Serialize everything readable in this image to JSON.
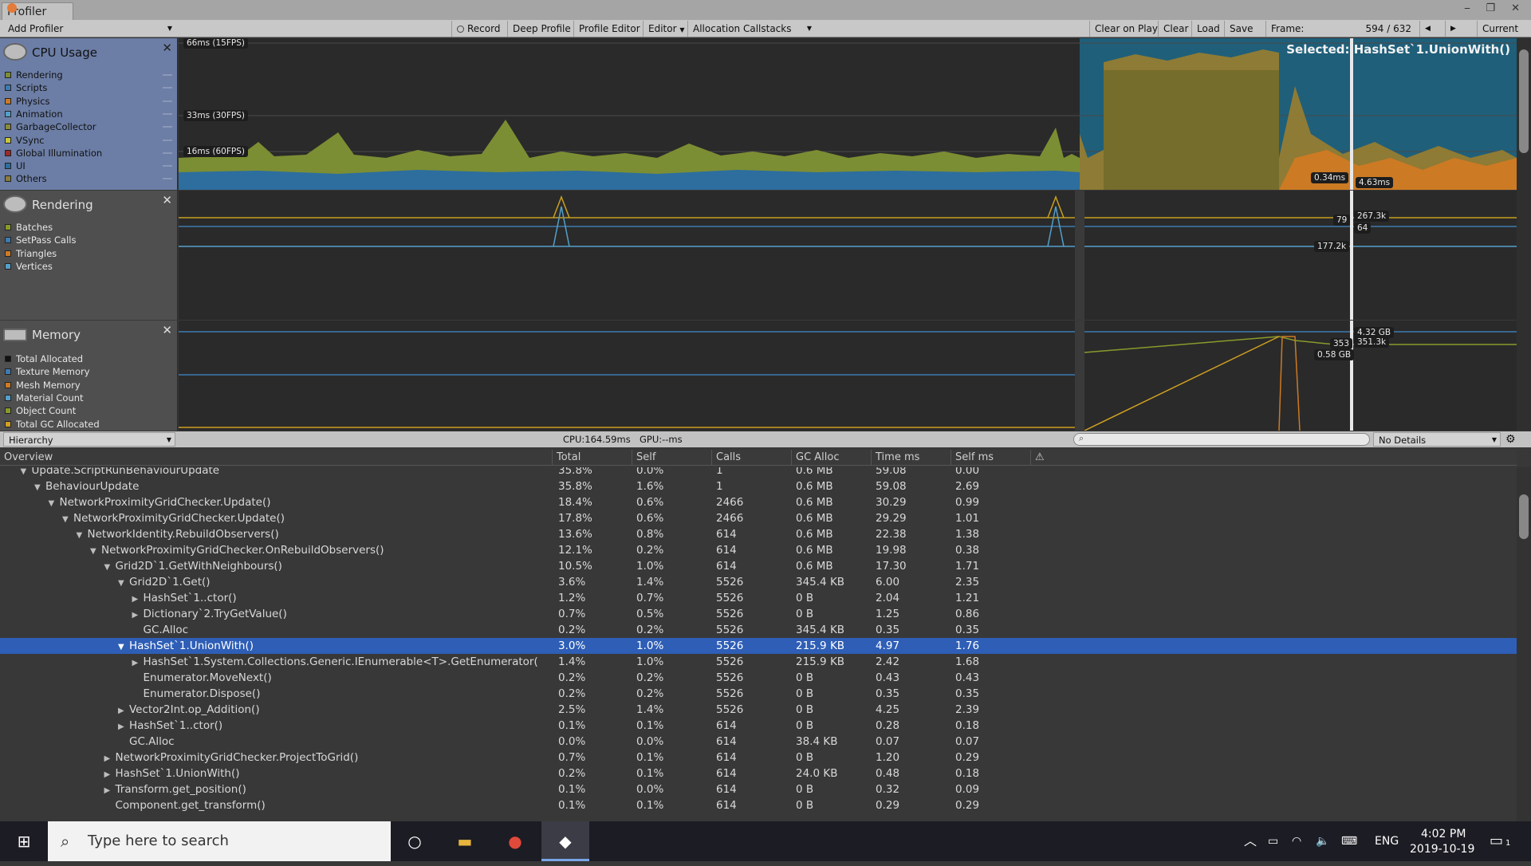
{
  "window": {
    "tab_title": "Profiler",
    "controls": "⎯ ❐ ✕"
  },
  "toolbar": {
    "add_profiler": "Add Profiler",
    "record": "Record",
    "deep_profile": "Deep Profile",
    "profile_editor": "Profile Editor",
    "editor": "Editor",
    "allocation_callstacks": "Allocation Callstacks",
    "clear_on_play": "Clear on Play",
    "clear": "Clear",
    "load": "Load",
    "save": "Save",
    "frame_label": "Frame:",
    "frame_value": "594 / 632",
    "prev": "◀",
    "next": "▶",
    "current": "Current"
  },
  "cpu": {
    "title": "CPU Usage",
    "items": [
      "Rendering",
      "Scripts",
      "Physics",
      "Animation",
      "GarbageCollector",
      "VSync",
      "Global Illumination",
      "UI",
      "Others"
    ],
    "colors": [
      "#7c8e33",
      "#3d7bb0",
      "#cc7a24",
      "#54a0c9",
      "#8a8a3a",
      "#c8c63a",
      "#9c2a2a",
      "#2d6e9e",
      "#8a7d3a"
    ],
    "label_66": "66ms (15FPS)",
    "label_33": "33ms (30FPS)",
    "label_16": "16ms (60FPS)",
    "selected": "Selected: HashSet`1.UnionWith()",
    "val_a": "0.34ms",
    "val_b": "4.63ms"
  },
  "rendering": {
    "title": "Rendering",
    "items": [
      "Batches",
      "SetPass Calls",
      "Triangles",
      "Vertices"
    ],
    "colors": [
      "#8a9a2a",
      "#3d7bb0",
      "#cc7a24",
      "#54a0c9"
    ],
    "val_79": "79",
    "val_267": "267.3k",
    "val_64": "64",
    "val_177": "177.2k"
  },
  "memory": {
    "title": "Memory",
    "items": [
      "Total Allocated",
      "Texture Memory",
      "Mesh Memory",
      "Material Count",
      "Object Count",
      "Total GC Allocated"
    ],
    "colors": [
      "#111111",
      "#3d7bb0",
      "#cc7a24",
      "#54a0c9",
      "#8a9a2a",
      "#d0a020"
    ],
    "val_432": "4.32 GB",
    "val_353": "353",
    "val_351": "351.3k",
    "val_058": "0.58 GB"
  },
  "strip": {
    "view": "Hierarchy",
    "cpu_time": "CPU:164.59ms",
    "gpu_time": "GPU:--ms",
    "details": "No Details"
  },
  "table": {
    "headers": [
      "Overview",
      "Total",
      "Self",
      "Calls",
      "GC Alloc",
      "Time ms",
      "Self ms"
    ],
    "rows": [
      {
        "depth": 1,
        "arrow": "▼",
        "name": "Update.ScriptRunBehaviourUpdate",
        "total": "35.8%",
        "self": "0.0%",
        "calls": "1",
        "gc": "0.6 MB",
        "time": "59.08",
        "selfms": "0.00"
      },
      {
        "depth": 2,
        "arrow": "▼",
        "name": "BehaviourUpdate",
        "total": "35.8%",
        "self": "1.6%",
        "calls": "1",
        "gc": "0.6 MB",
        "time": "59.08",
        "selfms": "2.69"
      },
      {
        "depth": 3,
        "arrow": "▼",
        "name": "NetworkProximityGridChecker.Update()",
        "total": "18.4%",
        "self": "0.6%",
        "calls": "2466",
        "gc": "0.6 MB",
        "time": "30.29",
        "selfms": "0.99"
      },
      {
        "depth": 4,
        "arrow": "▼",
        "name": "NetworkProximityGridChecker.Update()",
        "total": "17.8%",
        "self": "0.6%",
        "calls": "2466",
        "gc": "0.6 MB",
        "time": "29.29",
        "selfms": "1.01"
      },
      {
        "depth": 5,
        "arrow": "▼",
        "name": "NetworkIdentity.RebuildObservers()",
        "total": "13.6%",
        "self": "0.8%",
        "calls": "614",
        "gc": "0.6 MB",
        "time": "22.38",
        "selfms": "1.38"
      },
      {
        "depth": 6,
        "arrow": "▼",
        "name": "NetworkProximityGridChecker.OnRebuildObservers()",
        "total": "12.1%",
        "self": "0.2%",
        "calls": "614",
        "gc": "0.6 MB",
        "time": "19.98",
        "selfms": "0.38"
      },
      {
        "depth": 7,
        "arrow": "▼",
        "name": "Grid2D`1.GetWithNeighbours()",
        "total": "10.5%",
        "self": "1.0%",
        "calls": "614",
        "gc": "0.6 MB",
        "time": "17.30",
        "selfms": "1.71"
      },
      {
        "depth": 8,
        "arrow": "▼",
        "name": "Grid2D`1.Get()",
        "total": "3.6%",
        "self": "1.4%",
        "calls": "5526",
        "gc": "345.4 KB",
        "time": "6.00",
        "selfms": "2.35"
      },
      {
        "depth": 9,
        "arrow": "▶",
        "name": "HashSet`1..ctor()",
        "total": "1.2%",
        "self": "0.7%",
        "calls": "5526",
        "gc": "0 B",
        "time": "2.04",
        "selfms": "1.21"
      },
      {
        "depth": 9,
        "arrow": "▶",
        "name": "Dictionary`2.TryGetValue()",
        "total": "0.7%",
        "self": "0.5%",
        "calls": "5526",
        "gc": "0 B",
        "time": "1.25",
        "selfms": "0.86"
      },
      {
        "depth": 9,
        "arrow": "",
        "name": "GC.Alloc",
        "total": "0.2%",
        "self": "0.2%",
        "calls": "5526",
        "gc": "345.4 KB",
        "time": "0.35",
        "selfms": "0.35"
      },
      {
        "depth": 8,
        "arrow": "▼",
        "name": "HashSet`1.UnionWith()",
        "total": "3.0%",
        "self": "1.0%",
        "calls": "5526",
        "gc": "215.9 KB",
        "time": "4.97",
        "selfms": "1.76",
        "selected": true
      },
      {
        "depth": 9,
        "arrow": "▶",
        "name": "HashSet`1.System.Collections.Generic.IEnumerable<T>.GetEnumerator(",
        "total": "1.4%",
        "self": "1.0%",
        "calls": "5526",
        "gc": "215.9 KB",
        "time": "2.42",
        "selfms": "1.68"
      },
      {
        "depth": 9,
        "arrow": "",
        "name": "Enumerator.MoveNext()",
        "total": "0.2%",
        "self": "0.2%",
        "calls": "5526",
        "gc": "0 B",
        "time": "0.43",
        "selfms": "0.43"
      },
      {
        "depth": 9,
        "arrow": "",
        "name": "Enumerator.Dispose()",
        "total": "0.2%",
        "self": "0.2%",
        "calls": "5526",
        "gc": "0 B",
        "time": "0.35",
        "selfms": "0.35"
      },
      {
        "depth": 8,
        "arrow": "▶",
        "name": "Vector2Int.op_Addition()",
        "total": "2.5%",
        "self": "1.4%",
        "calls": "5526",
        "gc": "0 B",
        "time": "4.25",
        "selfms": "2.39"
      },
      {
        "depth": 8,
        "arrow": "▶",
        "name": "HashSet`1..ctor()",
        "total": "0.1%",
        "self": "0.1%",
        "calls": "614",
        "gc": "0 B",
        "time": "0.28",
        "selfms": "0.18"
      },
      {
        "depth": 8,
        "arrow": "",
        "name": "GC.Alloc",
        "total": "0.0%",
        "self": "0.0%",
        "calls": "614",
        "gc": "38.4 KB",
        "time": "0.07",
        "selfms": "0.07"
      },
      {
        "depth": 7,
        "arrow": "▶",
        "name": "NetworkProximityGridChecker.ProjectToGrid()",
        "total": "0.7%",
        "self": "0.1%",
        "calls": "614",
        "gc": "0 B",
        "time": "1.20",
        "selfms": "0.29"
      },
      {
        "depth": 7,
        "arrow": "▶",
        "name": "HashSet`1.UnionWith()",
        "total": "0.2%",
        "self": "0.1%",
        "calls": "614",
        "gc": "24.0 KB",
        "time": "0.48",
        "selfms": "0.18"
      },
      {
        "depth": 7,
        "arrow": "▶",
        "name": "Transform.get_position()",
        "total": "0.1%",
        "self": "0.0%",
        "calls": "614",
        "gc": "0 B",
        "time": "0.32",
        "selfms": "0.09"
      },
      {
        "depth": 7,
        "arrow": "",
        "name": "Component.get_transform()",
        "total": "0.1%",
        "self": "0.1%",
        "calls": "614",
        "gc": "0 B",
        "time": "0.29",
        "selfms": "0.29"
      }
    ]
  },
  "taskbar": {
    "search_placeholder": "Type here to search",
    "lang": "ENG",
    "time": "4:02 PM",
    "date": "2019-10-19",
    "notifications": "1"
  }
}
